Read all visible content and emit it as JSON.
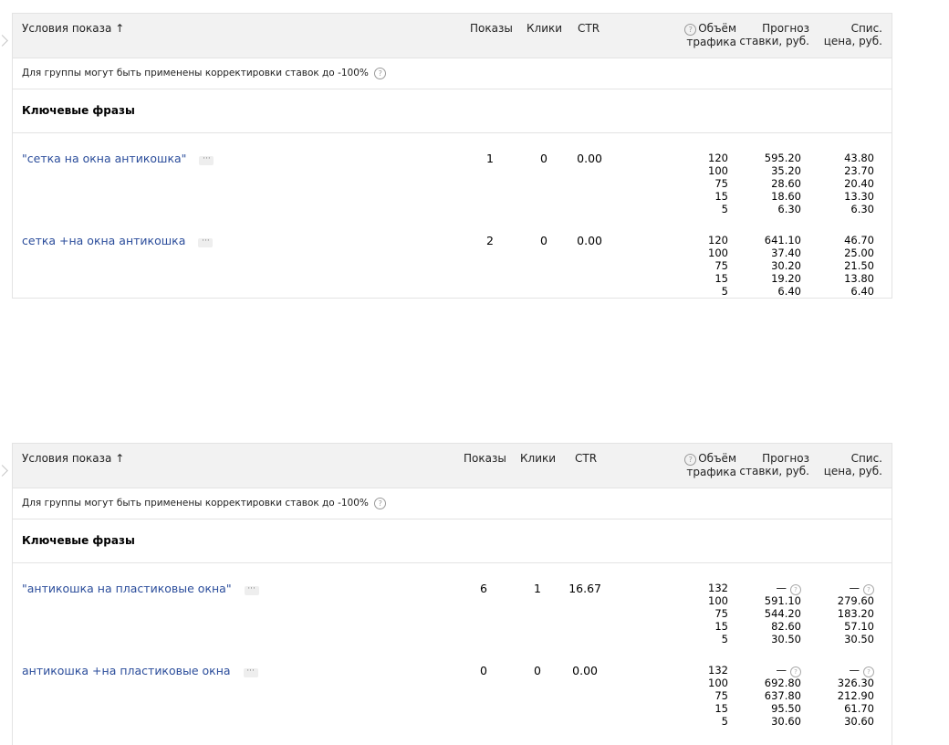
{
  "tables": [
    {
      "header": {
        "conditions": "Условия показа",
        "sort_arrow": "↑",
        "impressions": "Показы",
        "clicks": "Клики",
        "ctr": "CTR",
        "help_icon": "?",
        "traffic": [
          "Объём",
          "трафика"
        ],
        "forecast": [
          "Прогноз",
          "ставки, руб."
        ],
        "charge": [
          "Спис.",
          "цена, руб."
        ]
      },
      "note": "Для группы могут быть применены корректировки ставок до -100%",
      "section_title": "Ключевые фразы",
      "rows": [
        {
          "phrase": "\"сетка на окна антикошка\"",
          "menu": "···",
          "impressions": "1",
          "clicks": "0",
          "ctr": "0.00",
          "traffic": [
            "120",
            "100",
            "75",
            "15",
            "5"
          ],
          "forecast": [
            "595.20",
            "35.20",
            "28.60",
            "18.60",
            "6.30"
          ],
          "charge": [
            "43.80",
            "23.70",
            "20.40",
            "13.30",
            "6.30"
          ]
        },
        {
          "phrase": "сетка +на окна антикошка",
          "menu": "···",
          "impressions": "2",
          "clicks": "0",
          "ctr": "0.00",
          "traffic": [
            "120",
            "100",
            "75",
            "15",
            "5"
          ],
          "forecast": [
            "641.10",
            "37.40",
            "30.20",
            "19.20",
            "6.40"
          ],
          "charge": [
            "46.70",
            "25.00",
            "21.50",
            "13.80",
            "6.40"
          ]
        }
      ]
    },
    {
      "header": {
        "conditions": "Условия показа",
        "sort_arrow": "↑",
        "impressions": "Показы",
        "clicks": "Клики",
        "ctr": "CTR",
        "help_icon": "?",
        "traffic": [
          "Объём",
          "трафика"
        ],
        "forecast": [
          "Прогноз",
          "ставки, руб."
        ],
        "charge": [
          "Спис.",
          "цена, руб."
        ]
      },
      "note": "Для группы могут быть применены корректировки ставок до -100%",
      "section_title": "Ключевые фразы",
      "rows": [
        {
          "phrase": "\"антикошка на пластиковые окна\"",
          "menu": "···",
          "impressions": "6",
          "clicks": "1",
          "ctr": "16.67",
          "traffic": [
            "132",
            "100",
            "75",
            "15",
            "5"
          ],
          "forecast": [
            "—",
            "591.10",
            "544.20",
            "82.60",
            "30.50"
          ],
          "charge": [
            "—",
            "279.60",
            "183.20",
            "57.10",
            "30.50"
          ]
        },
        {
          "phrase": "антикошка +на пластиковые окна",
          "menu": "···",
          "impressions": "0",
          "clicks": "0",
          "ctr": "0.00",
          "traffic": [
            "132",
            "100",
            "75",
            "15",
            "5"
          ],
          "forecast": [
            "—",
            "692.80",
            "637.80",
            "95.50",
            "30.60"
          ],
          "charge": [
            "—",
            "326.30",
            "212.90",
            "61.70",
            "30.60"
          ]
        }
      ]
    }
  ]
}
